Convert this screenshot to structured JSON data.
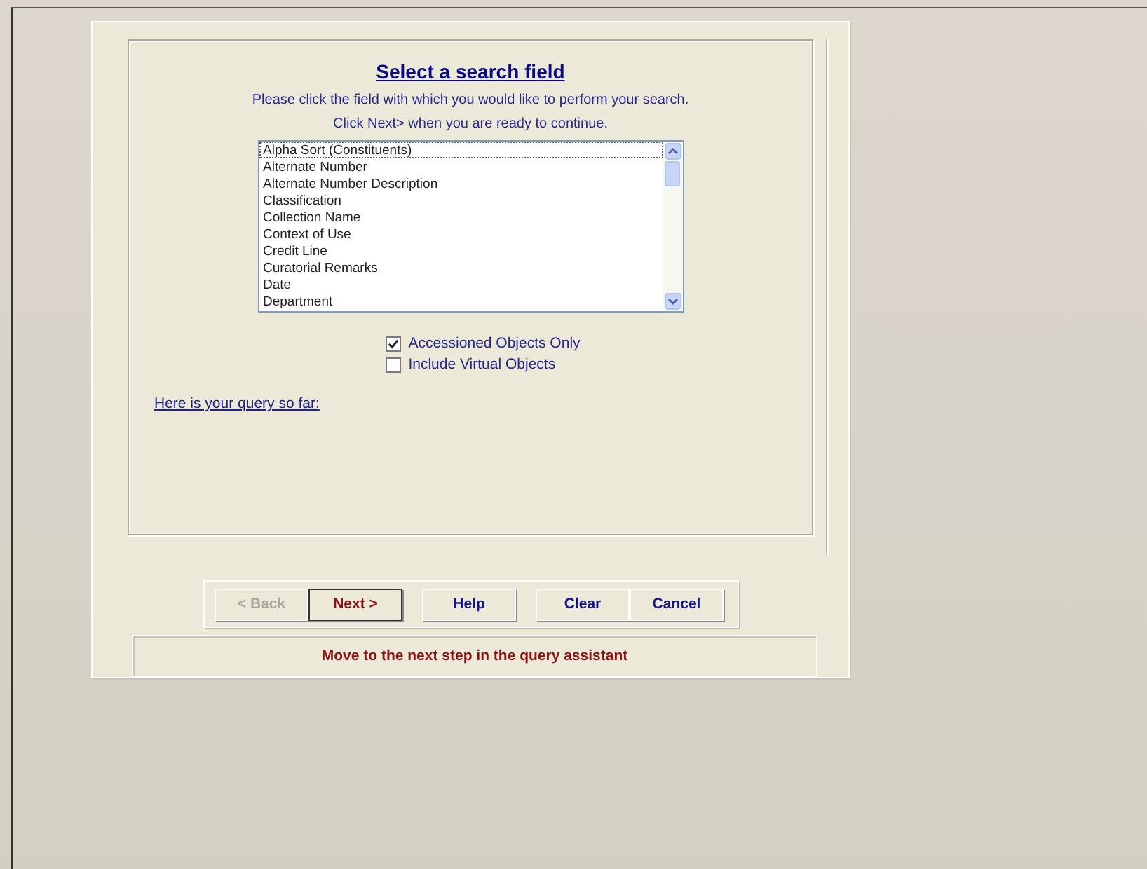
{
  "title": "Select a search field",
  "instructions": [
    "Please click the field with which you would like to perform your search.",
    "Click Next> when you are ready to continue."
  ],
  "fields": [
    {
      "label": "Alpha Sort (Constituents)",
      "selected": true
    },
    {
      "label": "Alternate Number",
      "selected": false
    },
    {
      "label": "Alternate Number Description",
      "selected": false
    },
    {
      "label": "Classification",
      "selected": false
    },
    {
      "label": "Collection Name",
      "selected": false
    },
    {
      "label": "Context of Use",
      "selected": false
    },
    {
      "label": "Credit Line",
      "selected": false
    },
    {
      "label": "Curatorial Remarks",
      "selected": false
    },
    {
      "label": "Date",
      "selected": false
    },
    {
      "label": "Department",
      "selected": false
    }
  ],
  "options": [
    {
      "label": "Accessioned Objects Only",
      "checked": true
    },
    {
      "label": "Include Virtual Objects",
      "checked": false
    }
  ],
  "query_link": "Here is your query so far:",
  "button_groups": [
    {
      "buttons": [
        {
          "label": "< Back",
          "disabled": true,
          "focused": false
        },
        {
          "label": "Next >",
          "disabled": false,
          "focused": true
        }
      ]
    },
    {
      "buttons": [
        {
          "label": "Help",
          "disabled": false,
          "focused": false
        }
      ]
    },
    {
      "buttons": [
        {
          "label": "Clear",
          "disabled": false,
          "focused": false
        },
        {
          "label": "Cancel",
          "disabled": false,
          "focused": false
        }
      ]
    }
  ],
  "status": "Move to the next step in the query assistant"
}
